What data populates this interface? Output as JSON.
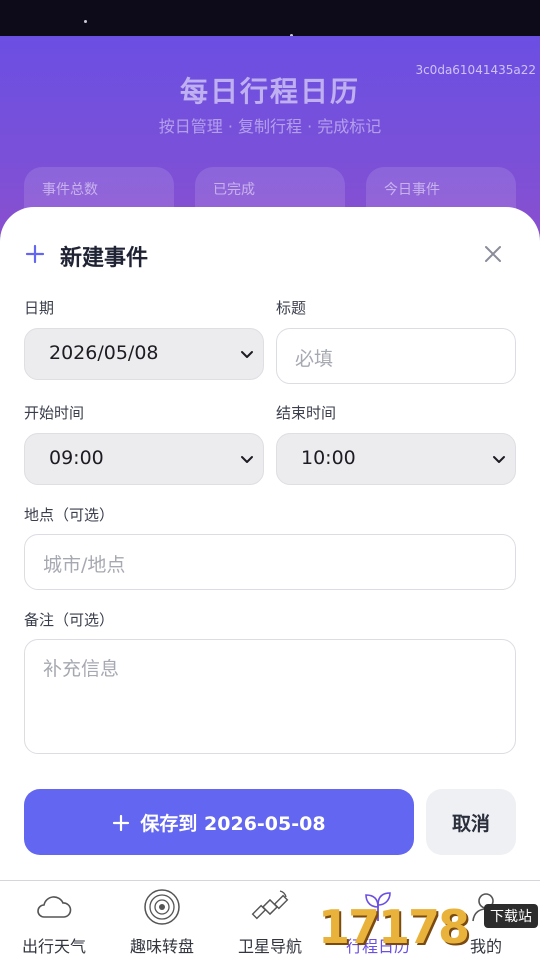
{
  "app": {
    "title": "每日行程日历",
    "subtitle": "按日管理 · 复制行程 · 完成标记",
    "code": "3c0da61041435a22"
  },
  "stats": [
    {
      "label": "事件总数"
    },
    {
      "label": "已完成"
    },
    {
      "label": "今日事件"
    }
  ],
  "sheet": {
    "title": "新建事件",
    "date_label": "日期",
    "date_value": "2026/05/08",
    "title_label": "标题",
    "title_placeholder": "必填",
    "start_label": "开始时间",
    "start_value": "09:00",
    "end_label": "结束时间",
    "end_value": "10:00",
    "location_label": "地点（可选）",
    "location_placeholder": "城市/地点",
    "notes_label": "备注（可选）",
    "notes_placeholder": "补充信息",
    "save_label": "保存到 2026-05-08",
    "cancel_label": "取消"
  },
  "tabs": [
    {
      "label": "出行天气",
      "icon": "cloud-icon"
    },
    {
      "label": "趣味转盘",
      "icon": "wheel-icon"
    },
    {
      "label": "卫星导航",
      "icon": "satellite-icon"
    },
    {
      "label": "行程日历",
      "icon": "sprout-icon",
      "active": true
    },
    {
      "label": "我的",
      "icon": "user-icon"
    }
  ],
  "watermark": {
    "number": "17178",
    "tag": "下载站"
  },
  "colors": {
    "accent": "#6366f0",
    "hero": "#6b4fe3",
    "active_tab": "#6b4fe3"
  }
}
